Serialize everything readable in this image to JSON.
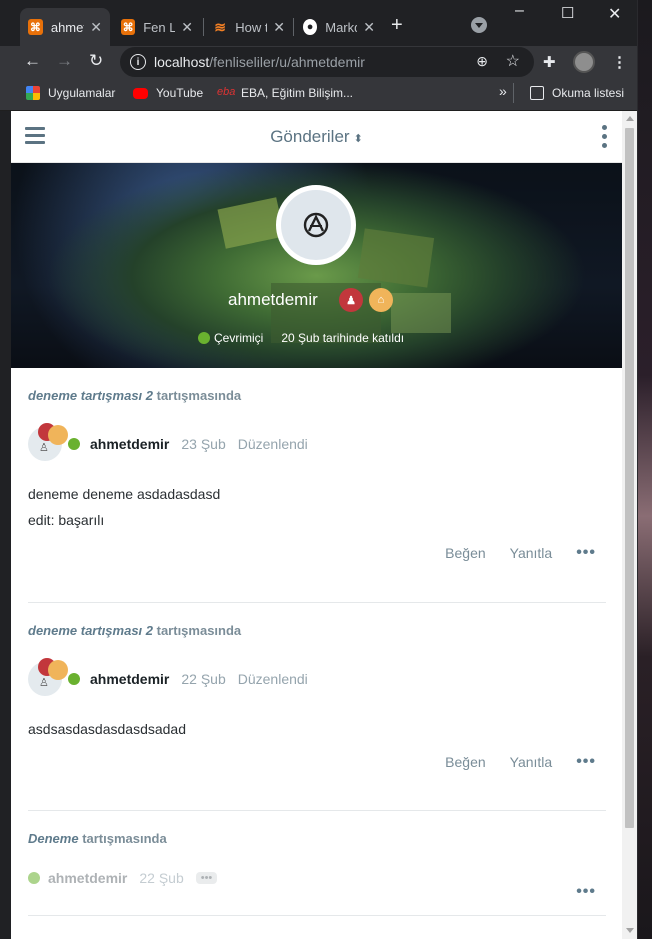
{
  "browser": {
    "tabs": [
      {
        "title": "ahmetdemir",
        "favicon_color": "#e8710a",
        "active": true
      },
      {
        "title": "Fen Liseliler",
        "favicon_color": "#e8710a",
        "active": false
      },
      {
        "title": "How to",
        "favicon_color": "#f48024",
        "active": false
      },
      {
        "title": "Markdown",
        "favicon_color": "#ffffff",
        "active": false
      }
    ],
    "url_host": "localhost",
    "url_path": "/fenliseliler/u/ahmetdemir",
    "window_controls": {
      "minimize": "–",
      "maximize": "☐",
      "close": "✕"
    },
    "bookmarks": [
      {
        "label": "Uygulamalar",
        "icon": "apps-grid-icon"
      },
      {
        "label": "YouTube",
        "icon": "youtube-icon"
      },
      {
        "label": "EBA, Eğitim Bilişim...",
        "icon": "eba-icon"
      }
    ],
    "reading_list": "Okuma listesi",
    "overflow": "»"
  },
  "appbar": {
    "title": "Gönderiler",
    "sort_icon": "⬍"
  },
  "profile": {
    "username": "ahmetdemir",
    "status": "Çevrimiçi",
    "joined": "20 Şub tarihinde katıldı"
  },
  "posts": [
    {
      "discussion": "deneme tartışması 2",
      "suffix": " tartışmasında",
      "author": "ahmetdemir",
      "date": "23 Şub",
      "edited": "Düzenlendi",
      "body": [
        "deneme deneme asdadasdasd",
        "edit: başarılı"
      ],
      "like": "Beğen",
      "reply": "Yanıtla",
      "more": "•••"
    },
    {
      "discussion": "deneme tartışması 2",
      "suffix": " tartışmasında",
      "author": "ahmetdemir",
      "date": "22 Şub",
      "edited": "Düzenlendi",
      "body": [
        "asdsasdasdasdasdsadad"
      ],
      "like": "Beğen",
      "reply": "Yanıtla",
      "more": "•••"
    },
    {
      "discussion": "Deneme",
      "suffix": " tartışmasında",
      "author": "ahmetdemir",
      "date": "22 Şub",
      "hidden_badge": "•••",
      "more": "•••"
    }
  ]
}
